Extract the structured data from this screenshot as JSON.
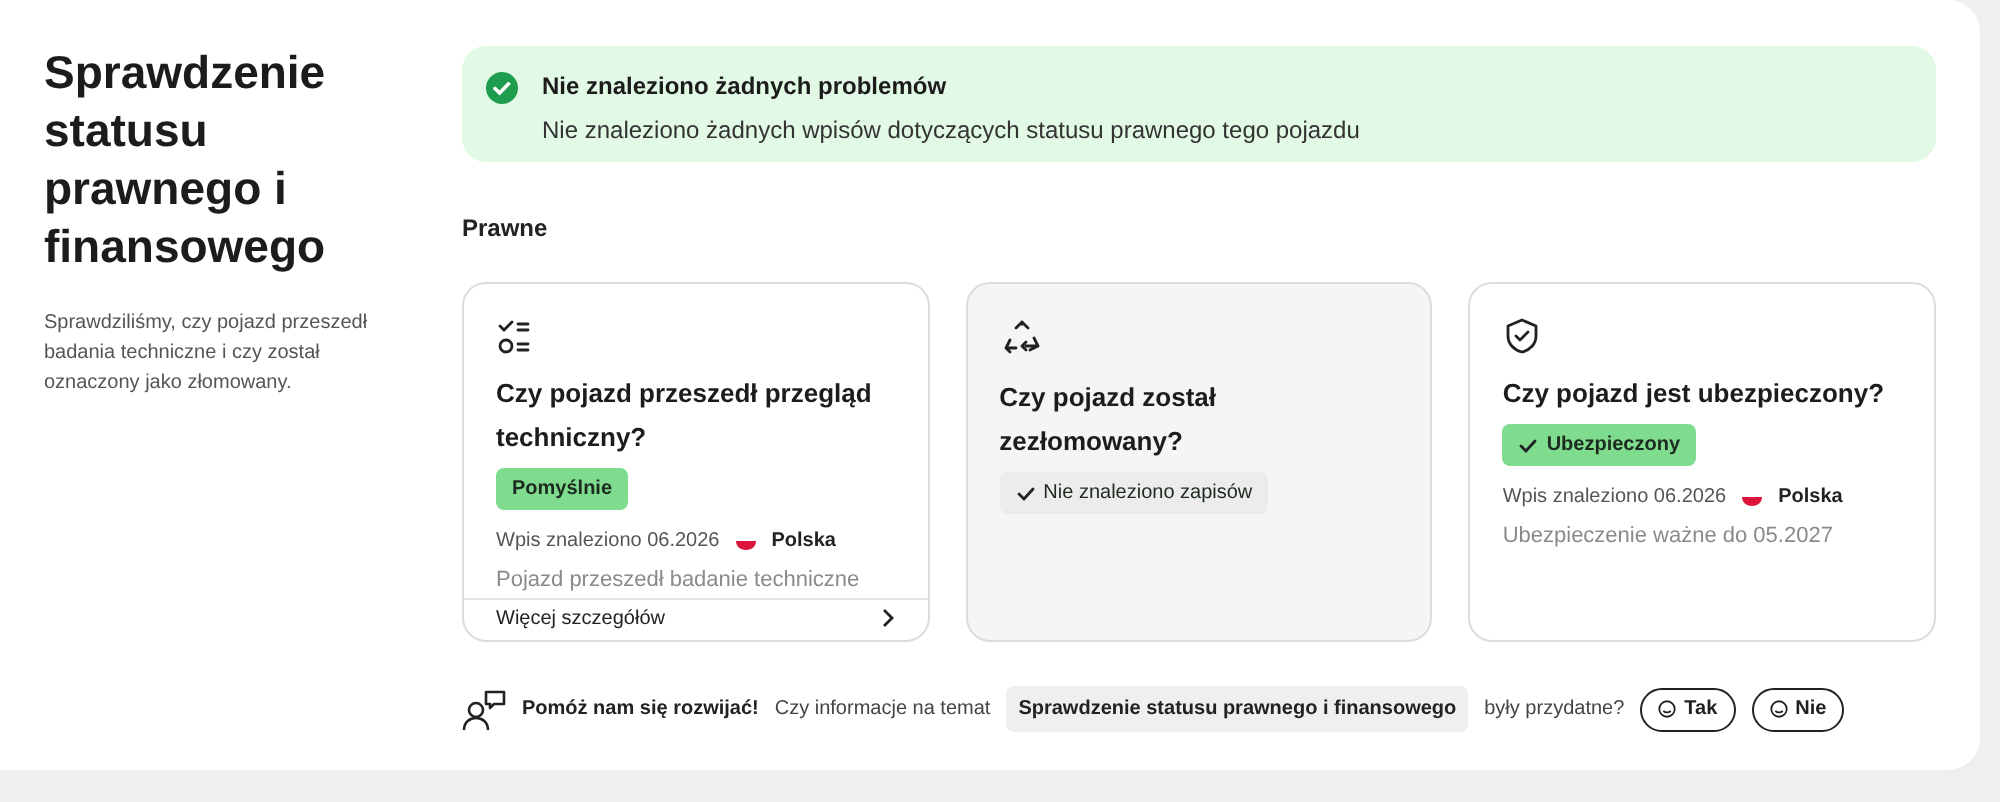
{
  "intro": {
    "title": "Sprawdzenie statusu prawnego i finansowego",
    "description": "Sprawdziliśmy, czy pojazd przeszedł badania techniczne i czy został oznaczony jako złomowany."
  },
  "banner": {
    "title": "Nie znaleziono żadnych problemów",
    "text": "Nie znaleziono żadnych wpisów dotyczących statusu prawnego tego pojazdu"
  },
  "section_title": "Prawne",
  "cards": [
    {
      "kind": "inspection",
      "color": "#ffffff",
      "title": "Czy pojazd przeszedł przegląd techniczny?",
      "badge": {
        "text": "Pomyślnie",
        "color": "#7fdc8e",
        "check": false
      },
      "entry": {
        "text": "Wpis znaleziono 06.2026",
        "country": "Polska"
      },
      "note": "Pojazd przeszedł badanie techniczne",
      "link": "Więcej szczegółów"
    },
    {
      "kind": "scrap",
      "color": "#f5f5f5",
      "title": "Czy pojazd został zezłomowany?",
      "badge": {
        "text": "Nie znaleziono zapisów",
        "color": "#ececec",
        "check": true
      }
    },
    {
      "kind": "insurance",
      "color": "#ffffff",
      "title": "Czy pojazd jest ubezpieczony?",
      "badge": {
        "text": "Ubezpieczony",
        "color": "#7fdc8e",
        "check": true
      },
      "entry": {
        "text": "Wpis znaleziono 06.2026",
        "country": "Polska"
      },
      "note": "Ubezpieczenie ważne do 05.2027"
    }
  ],
  "feedback": {
    "prompt": "Pomóż nam się rozwijać!",
    "question_start": "Czy informacje na temat",
    "topic": "Sprawdzenie statusu prawnego i finansowego",
    "question_end": "były przydatne?",
    "buttons": [
      "Tak",
      "Nie"
    ]
  }
}
